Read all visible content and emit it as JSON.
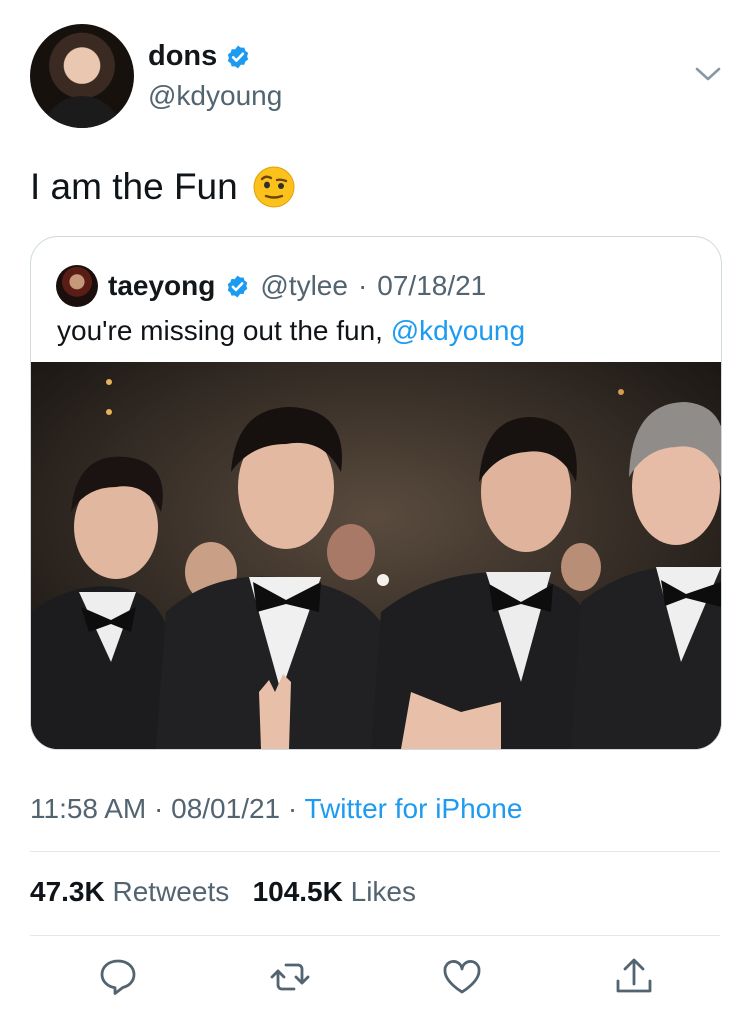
{
  "author": {
    "name": "dons",
    "handle": "@kdyoung"
  },
  "tweet": {
    "text": "I am the Fun",
    "emoji": "face-with-raised-eyebrow-emoji"
  },
  "quoted": {
    "name": "taeyong",
    "handle": "@tylee",
    "separator": "·",
    "date": "07/18/21",
    "text_prefix": "you're missing out the fun,",
    "mention": "@kdyoung"
  },
  "meta": {
    "time": "11:58 AM",
    "sep1": "·",
    "date": "08/01/21",
    "sep2": "·",
    "source": "Twitter for iPhone"
  },
  "stats": {
    "retweets_count": "47.3K",
    "retweets_label": "Retweets",
    "likes_count": "104.5K",
    "likes_label": "Likes"
  },
  "colors": {
    "link": "#1d9bf0",
    "verified": "#1d9bf0",
    "secondary_text": "#536471"
  },
  "icons": [
    "verified-badge-icon",
    "chevron-down-icon",
    "reply-icon",
    "retweet-icon",
    "like-icon",
    "share-icon"
  ]
}
